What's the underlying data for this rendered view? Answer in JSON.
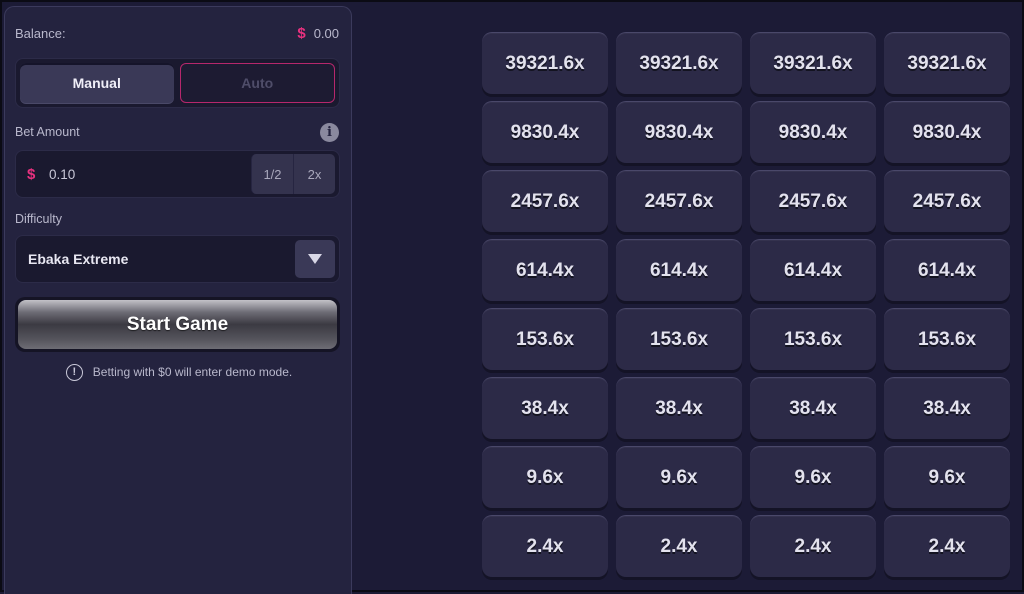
{
  "balance": {
    "label": "Balance:",
    "currency": "$",
    "value": "0.00"
  },
  "mode": {
    "manual": "Manual",
    "auto": "Auto",
    "active": "manual"
  },
  "bet": {
    "label": "Bet Amount",
    "info_icon": "info-icon",
    "currency": "$",
    "value": "0.10",
    "half_label": "1/2",
    "double_label": "2x"
  },
  "difficulty": {
    "label": "Difficulty",
    "selected": "Ebaka Extreme",
    "arrow_icon": "chevron-down-icon"
  },
  "start_button": {
    "label": "Start Game"
  },
  "demo_note": {
    "icon": "warning-icon",
    "text": "Betting with $0 will enter demo mode."
  },
  "multipliers": {
    "rows": [
      [
        "39321.6x",
        "39321.6x",
        "39321.6x",
        "39321.6x"
      ],
      [
        "9830.4x",
        "9830.4x",
        "9830.4x",
        "9830.4x"
      ],
      [
        "2457.6x",
        "2457.6x",
        "2457.6x",
        "2457.6x"
      ],
      [
        "614.4x",
        "614.4x",
        "614.4x",
        "614.4x"
      ],
      [
        "153.6x",
        "153.6x",
        "153.6x",
        "153.6x"
      ],
      [
        "38.4x",
        "38.4x",
        "38.4x",
        "38.4x"
      ],
      [
        "9.6x",
        "9.6x",
        "9.6x",
        "9.6x"
      ],
      [
        "2.4x",
        "2.4x",
        "2.4x",
        "2.4x"
      ]
    ]
  },
  "colors": {
    "accent_pink": "#e8317f",
    "background": "#1c1b36",
    "panel": "#24233f",
    "tile": "#2c2a47"
  }
}
